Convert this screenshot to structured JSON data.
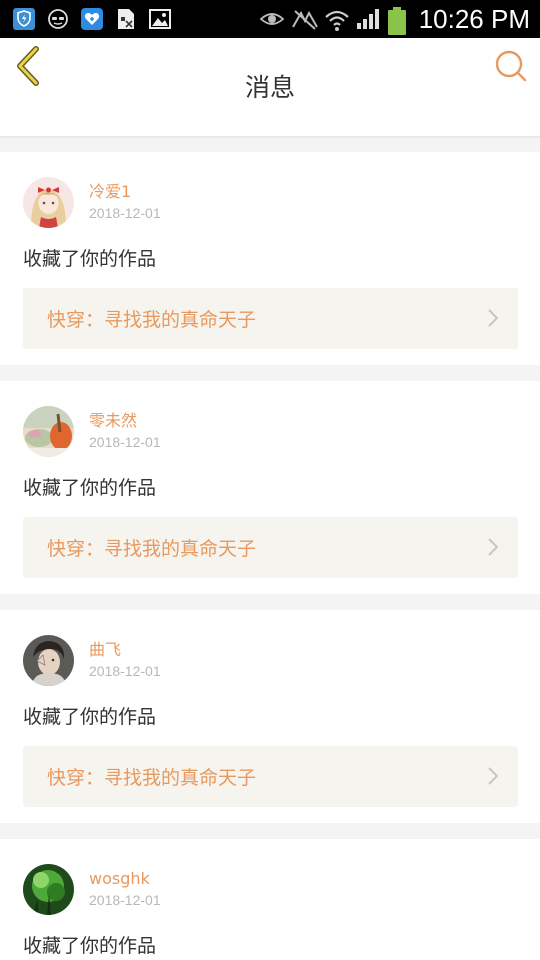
{
  "status_bar": {
    "time": "10:26 PM",
    "left_icons": [
      "shield-app-icon",
      "sunglasses-icon",
      "heart-app-icon",
      "sim-icon",
      "image-icon"
    ],
    "right_icons": [
      "eye-icon",
      "no-signal-icon",
      "wifi-icon",
      "signal-bars-icon",
      "battery-icon"
    ]
  },
  "header": {
    "title": "消息",
    "back_icon": "chevron-left-icon",
    "search_icon": "search-icon",
    "accent_color": "#e8995f"
  },
  "messages": [
    {
      "username": "冷爱1",
      "date": "2018-12-01",
      "action": "收藏了你的作品",
      "work_title": "快穿：寻找我的真命天子",
      "avatar": "anime-girl-avatar"
    },
    {
      "username": "零未然",
      "date": "2018-12-01",
      "action": "收藏了你的作品",
      "work_title": "快穿：寻找我的真命天子",
      "avatar": "food-avatar"
    },
    {
      "username": "曲飞",
      "date": "2018-12-01",
      "action": "收藏了你的作品",
      "work_title": "快穿：寻找我的真命天子",
      "avatar": "person-avatar"
    },
    {
      "username": "wosghk",
      "date": "2018-12-01",
      "action": "收藏了你的作品",
      "work_title": "",
      "avatar": "forest-avatar"
    }
  ]
}
